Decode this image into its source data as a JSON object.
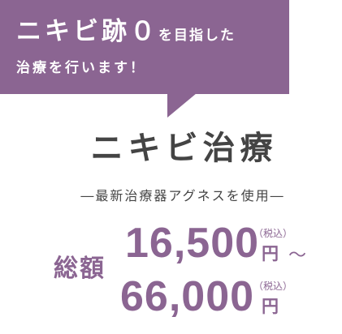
{
  "bubble": {
    "line1_big": "ニキビ跡０",
    "line1_small": "を目指した",
    "line2": "治療を行います！"
  },
  "title": "ニキビ治療",
  "subtitle": "―最新治療器アグネスを使用―",
  "pricing": {
    "total_label": "総額",
    "price_min": "16,500",
    "price_max": "66,000",
    "tax_note": "（税込）",
    "yen": "円",
    "tilde": "～"
  },
  "colors": {
    "accent": "#8b6592",
    "text": "#444444",
    "background": "#ffffff"
  }
}
